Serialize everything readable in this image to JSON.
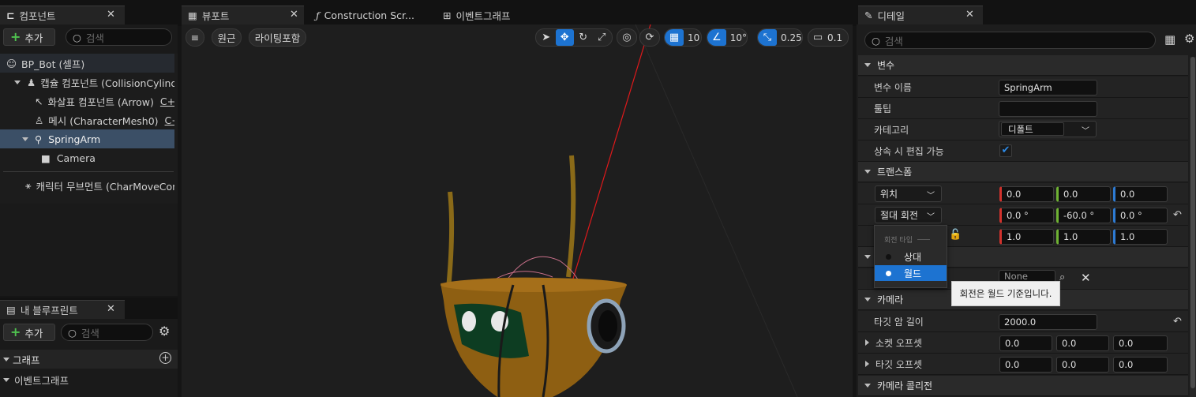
{
  "components_panel": {
    "tab_title": "컴포넌트",
    "add_label": "추가",
    "search_placeholder": "검색",
    "tree": [
      {
        "label": "BP_Bot (셀프)",
        "suffix": ""
      },
      {
        "label": "캡슐 컴포넌트 (CollisionCylinder)",
        "suffix": ""
      },
      {
        "label": "화살표 컴포넌트 (Arrow)",
        "suffix": "C+"
      },
      {
        "label": "메시 (CharacterMesh0)",
        "suffix": "C+"
      },
      {
        "label": "SpringArm",
        "suffix": ""
      },
      {
        "label": "Camera",
        "suffix": ""
      },
      {
        "label": "캐릭터 무브먼트 (CharMoveComp)",
        "suffix": ""
      }
    ]
  },
  "blueprint_panel": {
    "tab_title": "내 블루프린트",
    "add_label": "추가",
    "search_placeholder": "검색",
    "section_graph": "그래프",
    "event_graph": "이벤트그래프"
  },
  "viewport": {
    "tabs": [
      {
        "label": "뷰포트"
      },
      {
        "label": "Construction Scr..."
      },
      {
        "label": "이벤트그래프"
      }
    ],
    "view_mode": "원근",
    "lighting": "라이팅포함",
    "grid_snap": "10",
    "rotation_snap": "10°",
    "scale_snap": "0.25",
    "camera_speed": "0.1"
  },
  "details": {
    "tab_title": "디테일",
    "search_placeholder": "검색",
    "cat_variables": "변수",
    "var_name_label": "변수 이름",
    "var_name_value": "SpringArm",
    "tooltip_label": "툴팁",
    "tooltip_value": "",
    "category_label": "카테고리",
    "category_value": "디폴트",
    "editable_label": "상속 시 편집 가능",
    "cat_transform": "트랜스폼",
    "location_mode": "위치",
    "location": [
      "0.0",
      "0.0",
      "0.0"
    ],
    "rotation_mode": "절대 회전",
    "rotation": [
      "0.0 °",
      "-60.0 °",
      "0.0 °"
    ],
    "scale": [
      "1.0",
      "1.0",
      "1.0"
    ],
    "socket_value": "None",
    "cat_camera": "카메라",
    "target_arm_label": "타깃 암 길이",
    "target_arm_value": "2000.0",
    "socket_offset_label": "소켓 오프셋",
    "socket_offset": [
      "0.0",
      "0.0",
      "0.0"
    ],
    "target_offset_label": "타깃 오프셋",
    "target_offset": [
      "0.0",
      "0.0",
      "0.0"
    ],
    "cat_camera_collision": "카메라 콜리전"
  },
  "rotation_dropdown": {
    "header": "회전 타입",
    "options": [
      {
        "label": "상대"
      },
      {
        "label": "월드"
      }
    ],
    "selected": "월드",
    "tooltip": "회전은 월드 기준입니다."
  },
  "colors": {
    "accent": "#1d73d1",
    "selection": "#3b4f66"
  }
}
